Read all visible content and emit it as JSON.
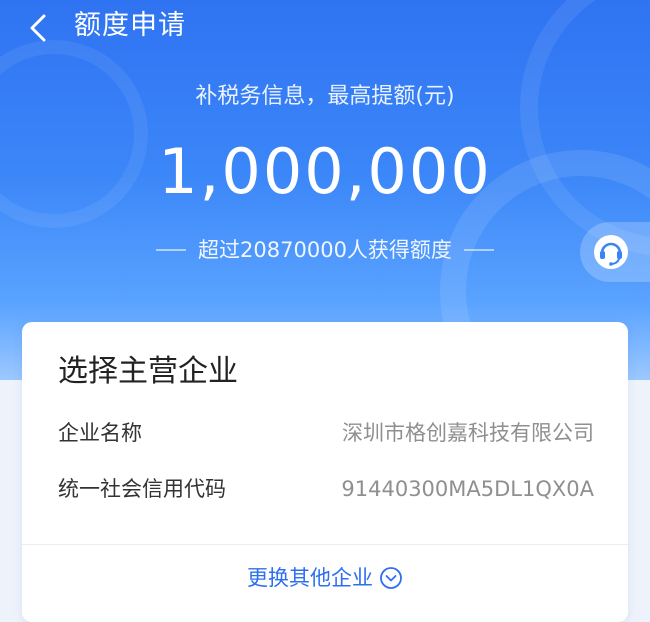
{
  "header": {
    "title": "额度申请",
    "back_icon": "chevron-left-icon"
  },
  "quota": {
    "subtitle": "补税务信息，最高提额(元)",
    "amount": "1,000,000",
    "stat": "超过20870000人获得额度"
  },
  "service": {
    "icon": "customer-service-icon"
  },
  "company_card": {
    "title": "选择主营企业",
    "rows": [
      {
        "label": "企业名称",
        "value": "深圳市格创嘉科技有限公司"
      },
      {
        "label": "统一社会信用代码",
        "value": "91440300MA5DL1QX0A"
      }
    ],
    "switch_label": "更换其他企业",
    "switch_icon": "chevron-down-circle-icon"
  },
  "colors": {
    "primary": "#2f73f2",
    "link": "#2d6ff0",
    "muted_text": "#8f8f8f"
  }
}
